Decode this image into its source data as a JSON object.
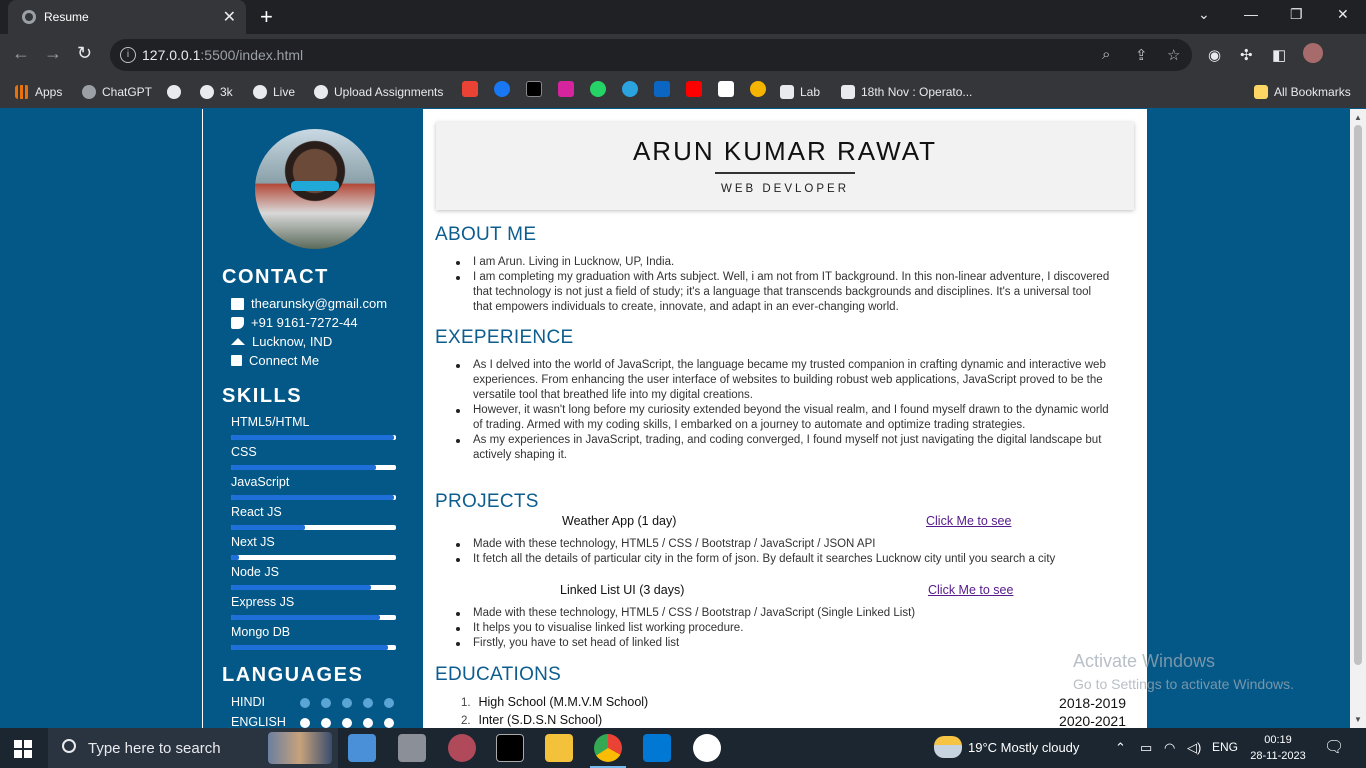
{
  "browser": {
    "tab_title": "Resume",
    "url_host": "127.0.0.1",
    "url_rest": ":5500/index.html",
    "bookmarks": [
      "Apps",
      "ChatGPT",
      "3k",
      "Live",
      "Upload Assignments",
      "Lab",
      "18th Nov : Operato..."
    ],
    "all_bookmarks": "All Bookmarks"
  },
  "sidebar": {
    "contact_heading": "CONTACT",
    "contact": [
      {
        "icon": "mail-icon",
        "text": "thearunsky@gmail.com"
      },
      {
        "icon": "phone-icon",
        "text": "+91 9161-7272-44"
      },
      {
        "icon": "home-icon",
        "text": "Lucknow, IND"
      },
      {
        "icon": "linkedin-icon",
        "text": "Connect Me"
      }
    ],
    "skills_heading": "SKILLS",
    "skills": [
      {
        "name": "HTML5/HTML",
        "level": 0.99
      },
      {
        "name": "CSS",
        "level": 0.88
      },
      {
        "name": "JavaScript",
        "level": 0.99
      },
      {
        "name": "React JS",
        "level": 0.45
      },
      {
        "name": "Next JS",
        "level": 0.05
      },
      {
        "name": "Node JS",
        "level": 0.85
      },
      {
        "name": "Express JS",
        "level": 0.9
      },
      {
        "name": "Mongo DB",
        "level": 0.95
      }
    ],
    "languages_heading": "LANGUAGES",
    "languages": [
      {
        "name": "HINDI",
        "dots": 5,
        "filled": 0
      },
      {
        "name": "ENGLISH",
        "dots": 5,
        "filled": 5
      }
    ]
  },
  "main": {
    "name": "ARUN KUMAR RAWAT",
    "role": "WEB DEVLOPER",
    "about_title": "ABOUT ME",
    "about": [
      "I am Arun. Living in Lucknow, UP, India.",
      "I am completing my graduation with Arts subject. Well, i am not from IT background. In this non-linear adventure, I discovered that technology is not just a field of study; it's a language that transcends backgrounds and disciplines. It's a universal tool that empowers individuals to create, innovate, and adapt in an ever-changing world."
    ],
    "experience_title": "EXEPERIENCE",
    "experience": [
      "As I delved into the world of JavaScript, the language became my trusted companion in crafting dynamic and interactive web experiences. From enhancing the user interface of websites to building robust web applications, JavaScript proved to be the versatile tool that breathed life into my digital creations.",
      "However, it wasn't long before my curiosity extended beyond the visual realm, and I found myself drawn to the dynamic world of trading. Armed with my coding skills, I embarked on a journey to automate and optimize trading strategies.",
      "As my experiences in JavaScript, trading, and coding converged, I found myself not just navigating the digital landscape but actively shaping it."
    ],
    "projects_title": "PROJECTS",
    "projects": [
      {
        "name": "Weather App (1 day)",
        "link": "Click Me to see",
        "points": [
          "Made with these technology, HTML5 / CSS / Bootstrap / JavaScript / JSON API",
          "It fetch all the details of particular city in the form of json. By default it searches Lucknow city until you search a city"
        ]
      },
      {
        "name": "Linked List UI (3 days)",
        "link": "Click Me to see",
        "points": [
          "Made with these technology, HTML5 / CSS / Bootstrap / JavaScript (Single Linked List)",
          "It helps you to visualise linked list working procedure.",
          "Firstly, you have to set head of linked list"
        ]
      }
    ],
    "education_title": "EDUCATIONS",
    "education": [
      {
        "num": "1.",
        "school": "High School (M.M.V.M School)",
        "year": "2018-2019"
      },
      {
        "num": "2.",
        "school": "Inter (S.D.S.N School)",
        "year": "2020-2021"
      }
    ]
  },
  "watermark": {
    "line1": "Activate Windows",
    "line2": "Go to Settings to activate Windows."
  },
  "taskbar": {
    "search_placeholder": "Type here to search",
    "weather": "19°C  Mostly cloudy",
    "lang": "ENG",
    "time": "00:19",
    "date": "28-11-2023"
  }
}
